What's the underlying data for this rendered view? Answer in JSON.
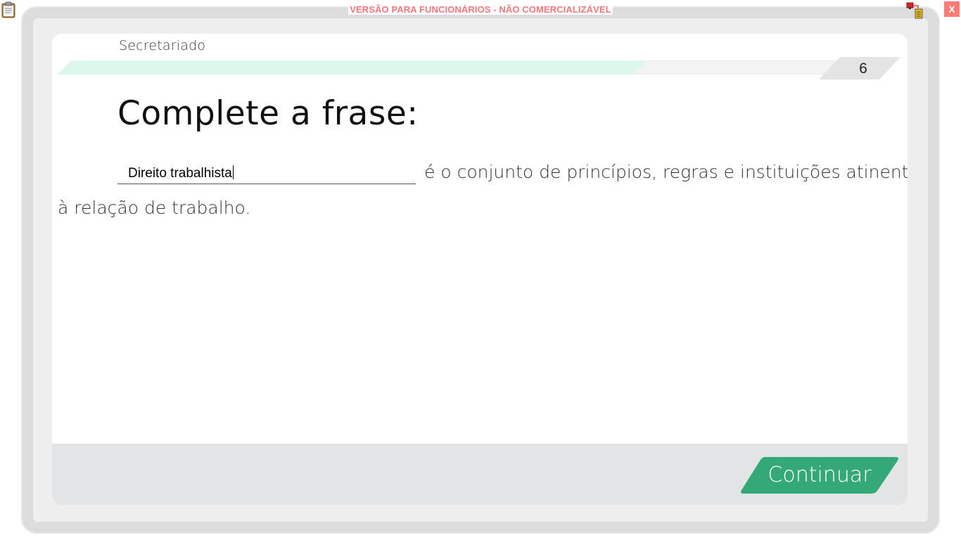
{
  "app": {
    "watermark": "VERSÃO PARA FUNCIONÁRIOS - NÃO COMERCIALIZÁVEL",
    "close_label": "X"
  },
  "lesson": {
    "subject": "Secretariado",
    "page_number": "6",
    "progress_fraction": 0.75
  },
  "exercise": {
    "title": "Complete a frase:",
    "answer_value": "Direito trabalhista",
    "sentence_rest": "é o conjunto de princípios, regras e instituições atinentes",
    "sentence_line2": "à relação de trabalho."
  },
  "footer": {
    "continue_label": "Continuar"
  },
  "colors": {
    "progress_fill": "#dcf7ec",
    "progress_empty": "#f3f3f3",
    "continue_green": "#35a878",
    "close_red": "#ff7a74",
    "watermark_red": "#f0787c"
  }
}
